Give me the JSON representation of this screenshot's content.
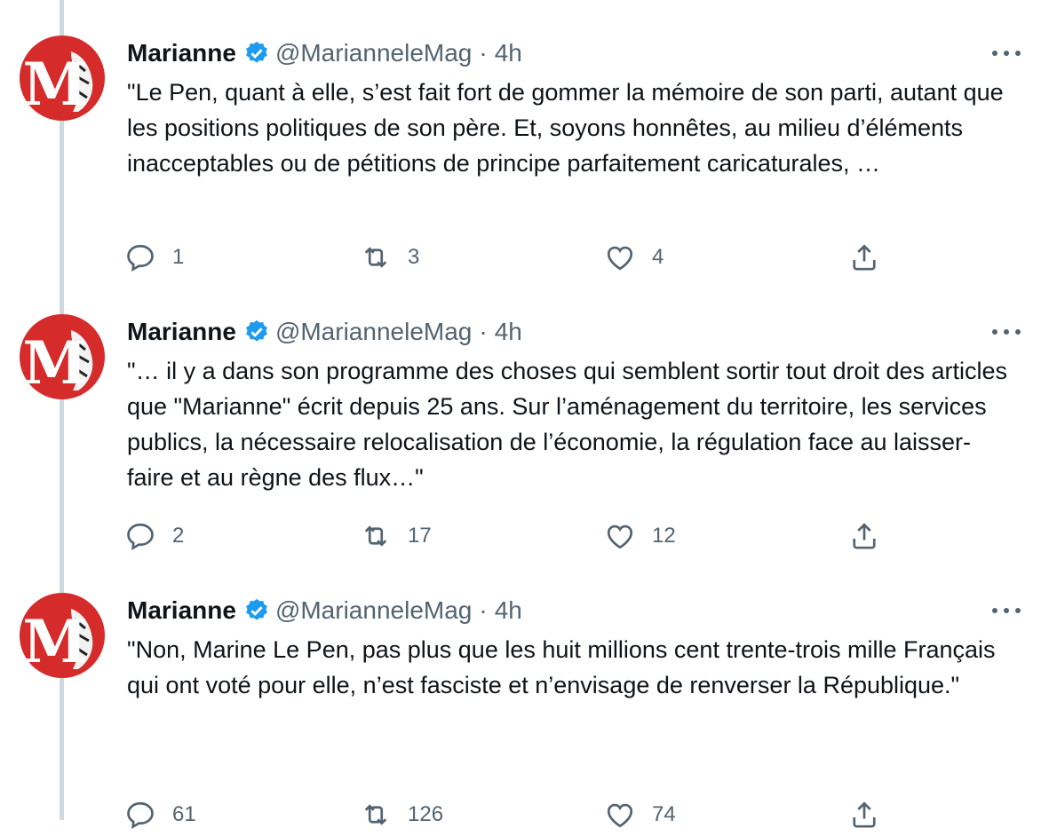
{
  "colors": {
    "accent": "#1d9bf0",
    "muted": "#536471",
    "text": "#0f1419",
    "thread_line": "#cfd9de",
    "avatar_red": "#d52b2b"
  },
  "icons": {
    "verified": "verified-badge-icon",
    "more": "more-dots-icon",
    "reply": "reply-icon",
    "retweet": "retweet-icon",
    "like": "heart-icon",
    "share": "share-icon"
  },
  "avatar_logo_letter": "M",
  "tweets": [
    {
      "name": "Marianne",
      "handle": "@MarianneleMag",
      "separator": "·",
      "time": "4h",
      "text": "\"Le Pen, quant à elle, s’est fait fort de gommer la mémoire de son parti, autant que les positions politiques de son père. Et, soyons honnêtes, au milieu d’éléments inacceptables ou de pétitions de principe parfaitement caricaturales, …",
      "replies": "1",
      "retweets": "3",
      "likes": "4"
    },
    {
      "name": "Marianne",
      "handle": "@MarianneleMag",
      "separator": "·",
      "time": "4h",
      "text": "\"… il y a dans son programme des choses qui semblent sortir tout droit des articles que \"Marianne\" écrit depuis 25 ans. Sur l’aménagement du territoire, les services publics, la nécessaire relocalisation de l’économie, la régulation face au laisser-faire et au règne des flux…\"",
      "replies": "2",
      "retweets": "17",
      "likes": "12"
    },
    {
      "name": "Marianne",
      "handle": "@MarianneleMag",
      "separator": "·",
      "time": "4h",
      "text": "\"Non, Marine Le Pen, pas plus que les huit millions cent trente-trois mille Français qui ont voté pour elle, n’est fasciste et n’envisage de renverser la République.\"",
      "replies": "61",
      "retweets": "126",
      "likes": "74"
    }
  ]
}
